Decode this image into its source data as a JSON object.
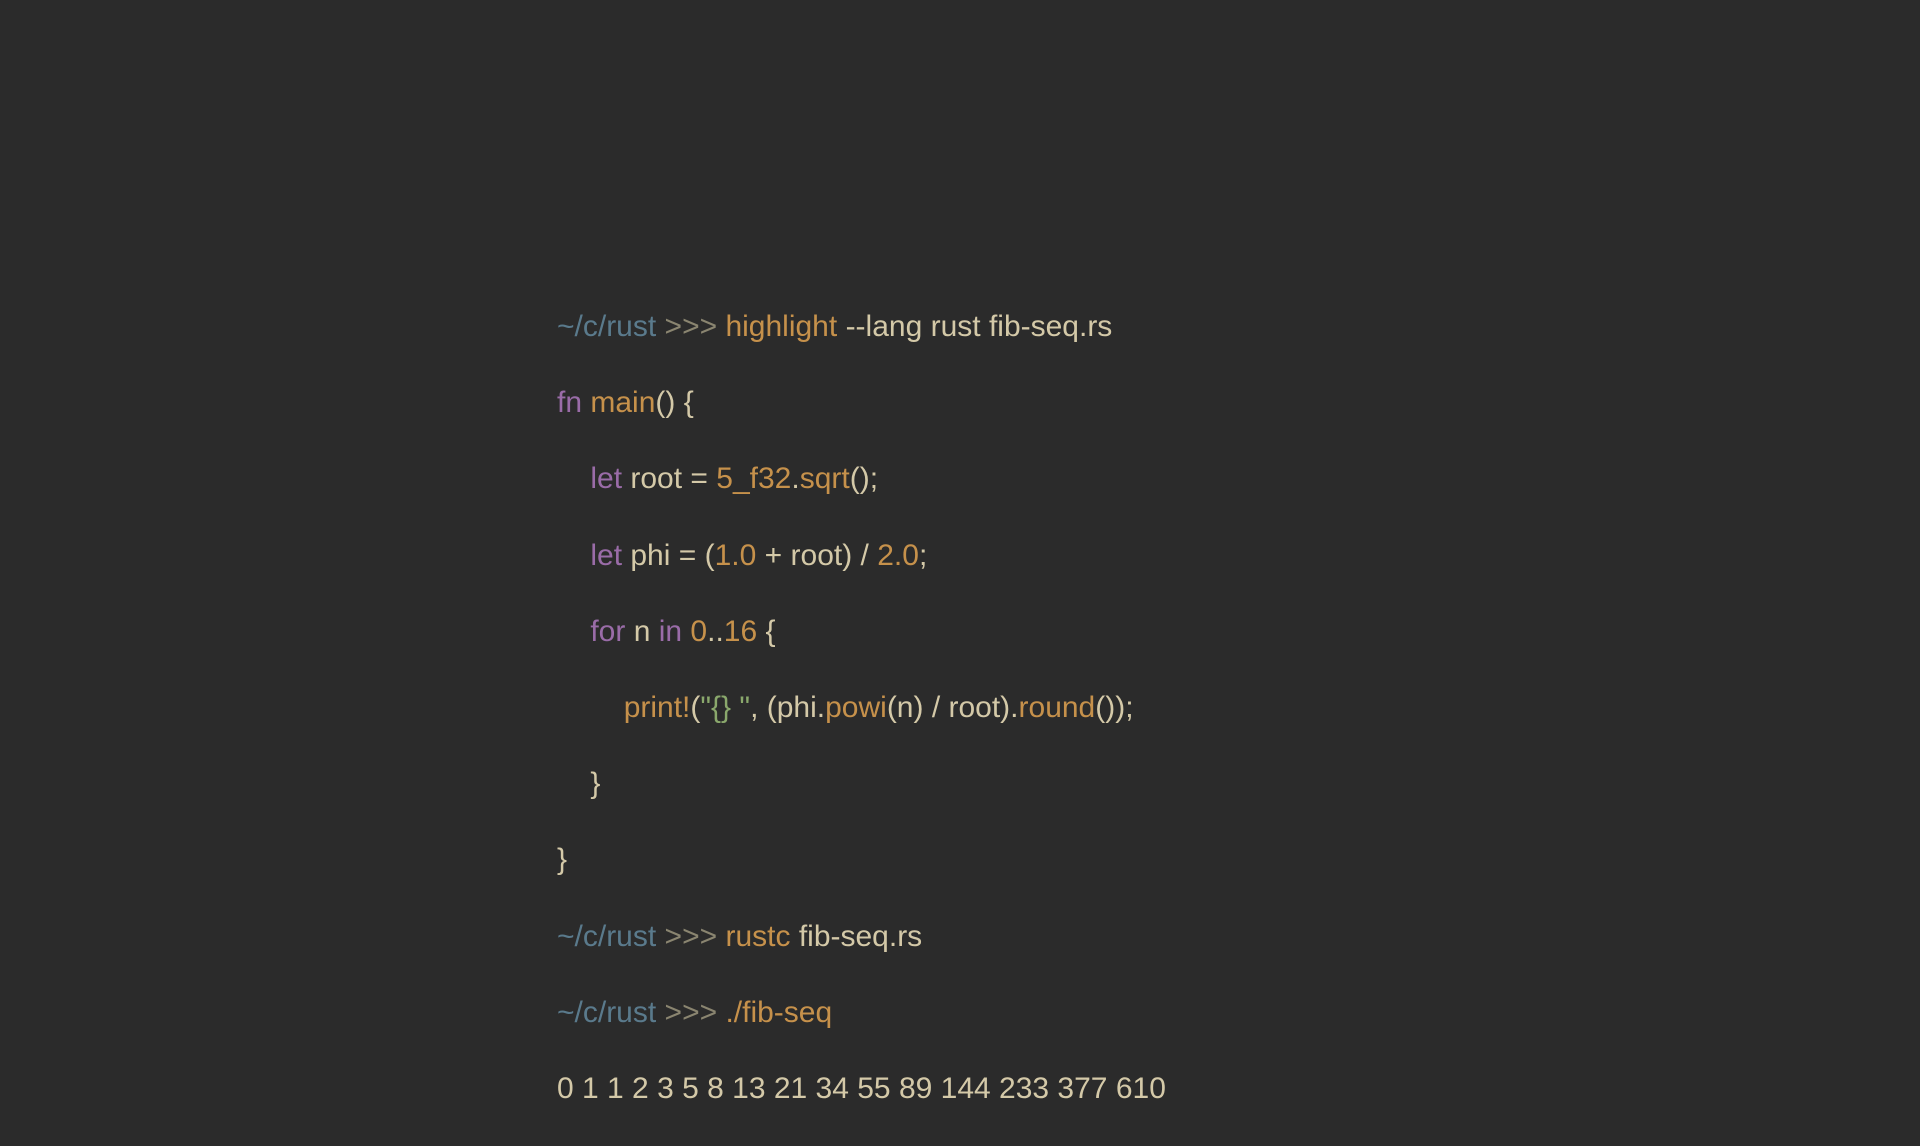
{
  "prompt": {
    "path": "~/c/rust",
    "arrows": ">>>"
  },
  "commands": {
    "highlight": {
      "cmd": "highlight",
      "args": "--lang rust fib-seq.rs"
    },
    "rustc": {
      "cmd": "rustc",
      "args": "fib-seq.rs"
    },
    "run": {
      "cmd": "./fib-seq"
    }
  },
  "code": {
    "fn_keyword": "fn",
    "fn_name": "main",
    "fn_parens": "()",
    "brace_open": " {",
    "let_keyword": "let",
    "root_var": "root",
    "equals": " = ",
    "five_f32": "5_f32",
    "dot": ".",
    "sqrt": "sqrt",
    "call_end": "();",
    "phi_var": "phi",
    "phi_expr_open": " = (",
    "one_point_zero": "1.0",
    "plus_root": " + root) / ",
    "two_point_zero": "2.0",
    "semicolon": ";",
    "for_keyword": "for",
    "n_var": " n ",
    "in_keyword": "in",
    "space": " ",
    "zero": "0",
    "dotdot": "..",
    "sixteen": "16",
    "for_brace": " {",
    "print_macro": "print!",
    "print_open": "(",
    "format_string": "\"{} \"",
    "comma_phi": ", (phi.",
    "powi": "powi",
    "powi_args": "(n) / root).",
    "round": "round",
    "print_end": "());",
    "brace_close_inner": "}",
    "brace_close_outer": "}"
  },
  "output": "0 1 1 2 3 5 8 13 21 34 55 89 144 233 377 610"
}
